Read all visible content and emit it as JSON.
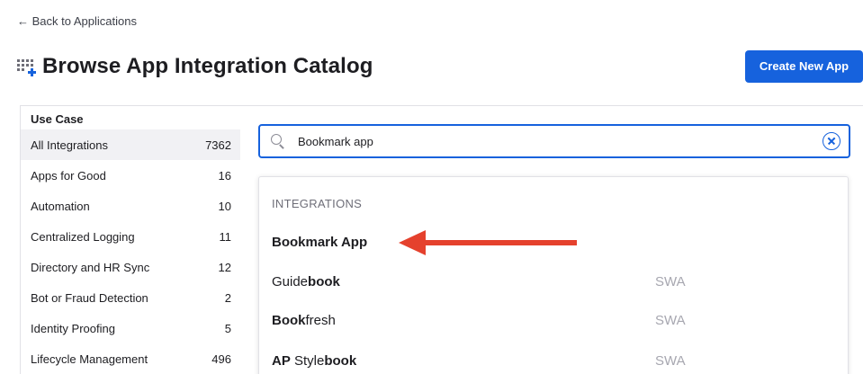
{
  "nav": {
    "back_label": "← Back to Applications"
  },
  "header": {
    "title": "Browse App Integration Catalog",
    "icon": "grid-plus-icon"
  },
  "actions": {
    "create_label": "Create New App"
  },
  "sidebar": {
    "heading": "Use Case",
    "items": [
      {
        "label": "All Integrations",
        "count": "7362",
        "active": true
      },
      {
        "label": "Apps for Good",
        "count": "16"
      },
      {
        "label": "Automation",
        "count": "10"
      },
      {
        "label": "Centralized Logging",
        "count": "11"
      },
      {
        "label": "Directory and HR Sync",
        "count": "12"
      },
      {
        "label": "Bot or Fraud Detection",
        "count": "2"
      },
      {
        "label": "Identity Proofing",
        "count": "5"
      },
      {
        "label": "Lifecycle Management",
        "count": "496"
      }
    ]
  },
  "search": {
    "value": "Bookmark app",
    "icon": "search-icon",
    "clear_icon": "clear-circle-x-icon"
  },
  "results": {
    "heading": "INTEGRATIONS",
    "items": [
      {
        "parts": [
          {
            "text": "Bookmark App",
            "bold": true
          }
        ],
        "tag": ""
      },
      {
        "parts": [
          {
            "text": "Guide",
            "bold": false
          },
          {
            "text": "book",
            "bold": true
          }
        ],
        "tag": "SWA"
      },
      {
        "parts": [
          {
            "text": "Book",
            "bold": true
          },
          {
            "text": "fresh",
            "bold": false
          }
        ],
        "tag": "SWA"
      },
      {
        "parts": [
          {
            "text": "AP",
            "bold": true
          },
          {
            "text": " Style",
            "bold": false
          },
          {
            "text": "book",
            "bold": true
          }
        ],
        "tag": "SWA"
      }
    ]
  },
  "colors": {
    "accent": "#1662dd",
    "annotation_arrow": "#e5412d"
  }
}
